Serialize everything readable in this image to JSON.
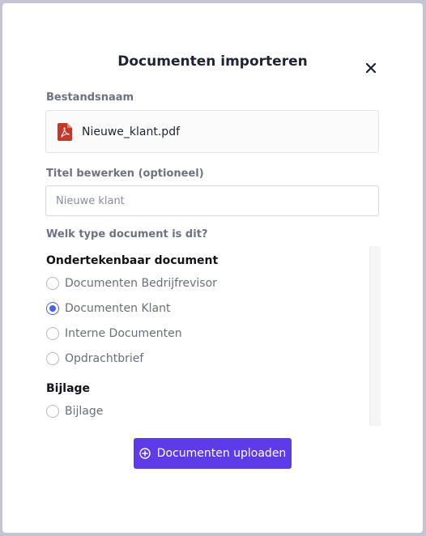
{
  "dialog": {
    "title": "Documenten importeren",
    "close_icon": "close-icon"
  },
  "file": {
    "label": "Bestandsnaam",
    "name": "Nieuwe_klant.pdf",
    "icon": "pdf-file-icon",
    "icon_color": "#c0392b"
  },
  "title_field": {
    "label": "Titel bewerken (optioneel)",
    "placeholder": "Nieuwe klant",
    "value": ""
  },
  "doc_type": {
    "question": "Welk type document is dit?",
    "groups": [
      {
        "title": "Ondertekenbaar document",
        "options": [
          {
            "label": "Documenten Bedrijfrevisor",
            "checked": false
          },
          {
            "label": "Documenten Klant",
            "checked": true
          },
          {
            "label": "Interne Documenten",
            "checked": false
          },
          {
            "label": "Opdrachtbrief",
            "checked": false
          }
        ]
      },
      {
        "title": "Bijlage",
        "options": [
          {
            "label": "Bijlage",
            "checked": false
          }
        ]
      }
    ]
  },
  "upload_button": {
    "label": "Documenten uploaden",
    "icon": "plus-circle-icon",
    "color": "#5d3be8"
  },
  "colors": {
    "radio_selected": "#4a63e0"
  }
}
